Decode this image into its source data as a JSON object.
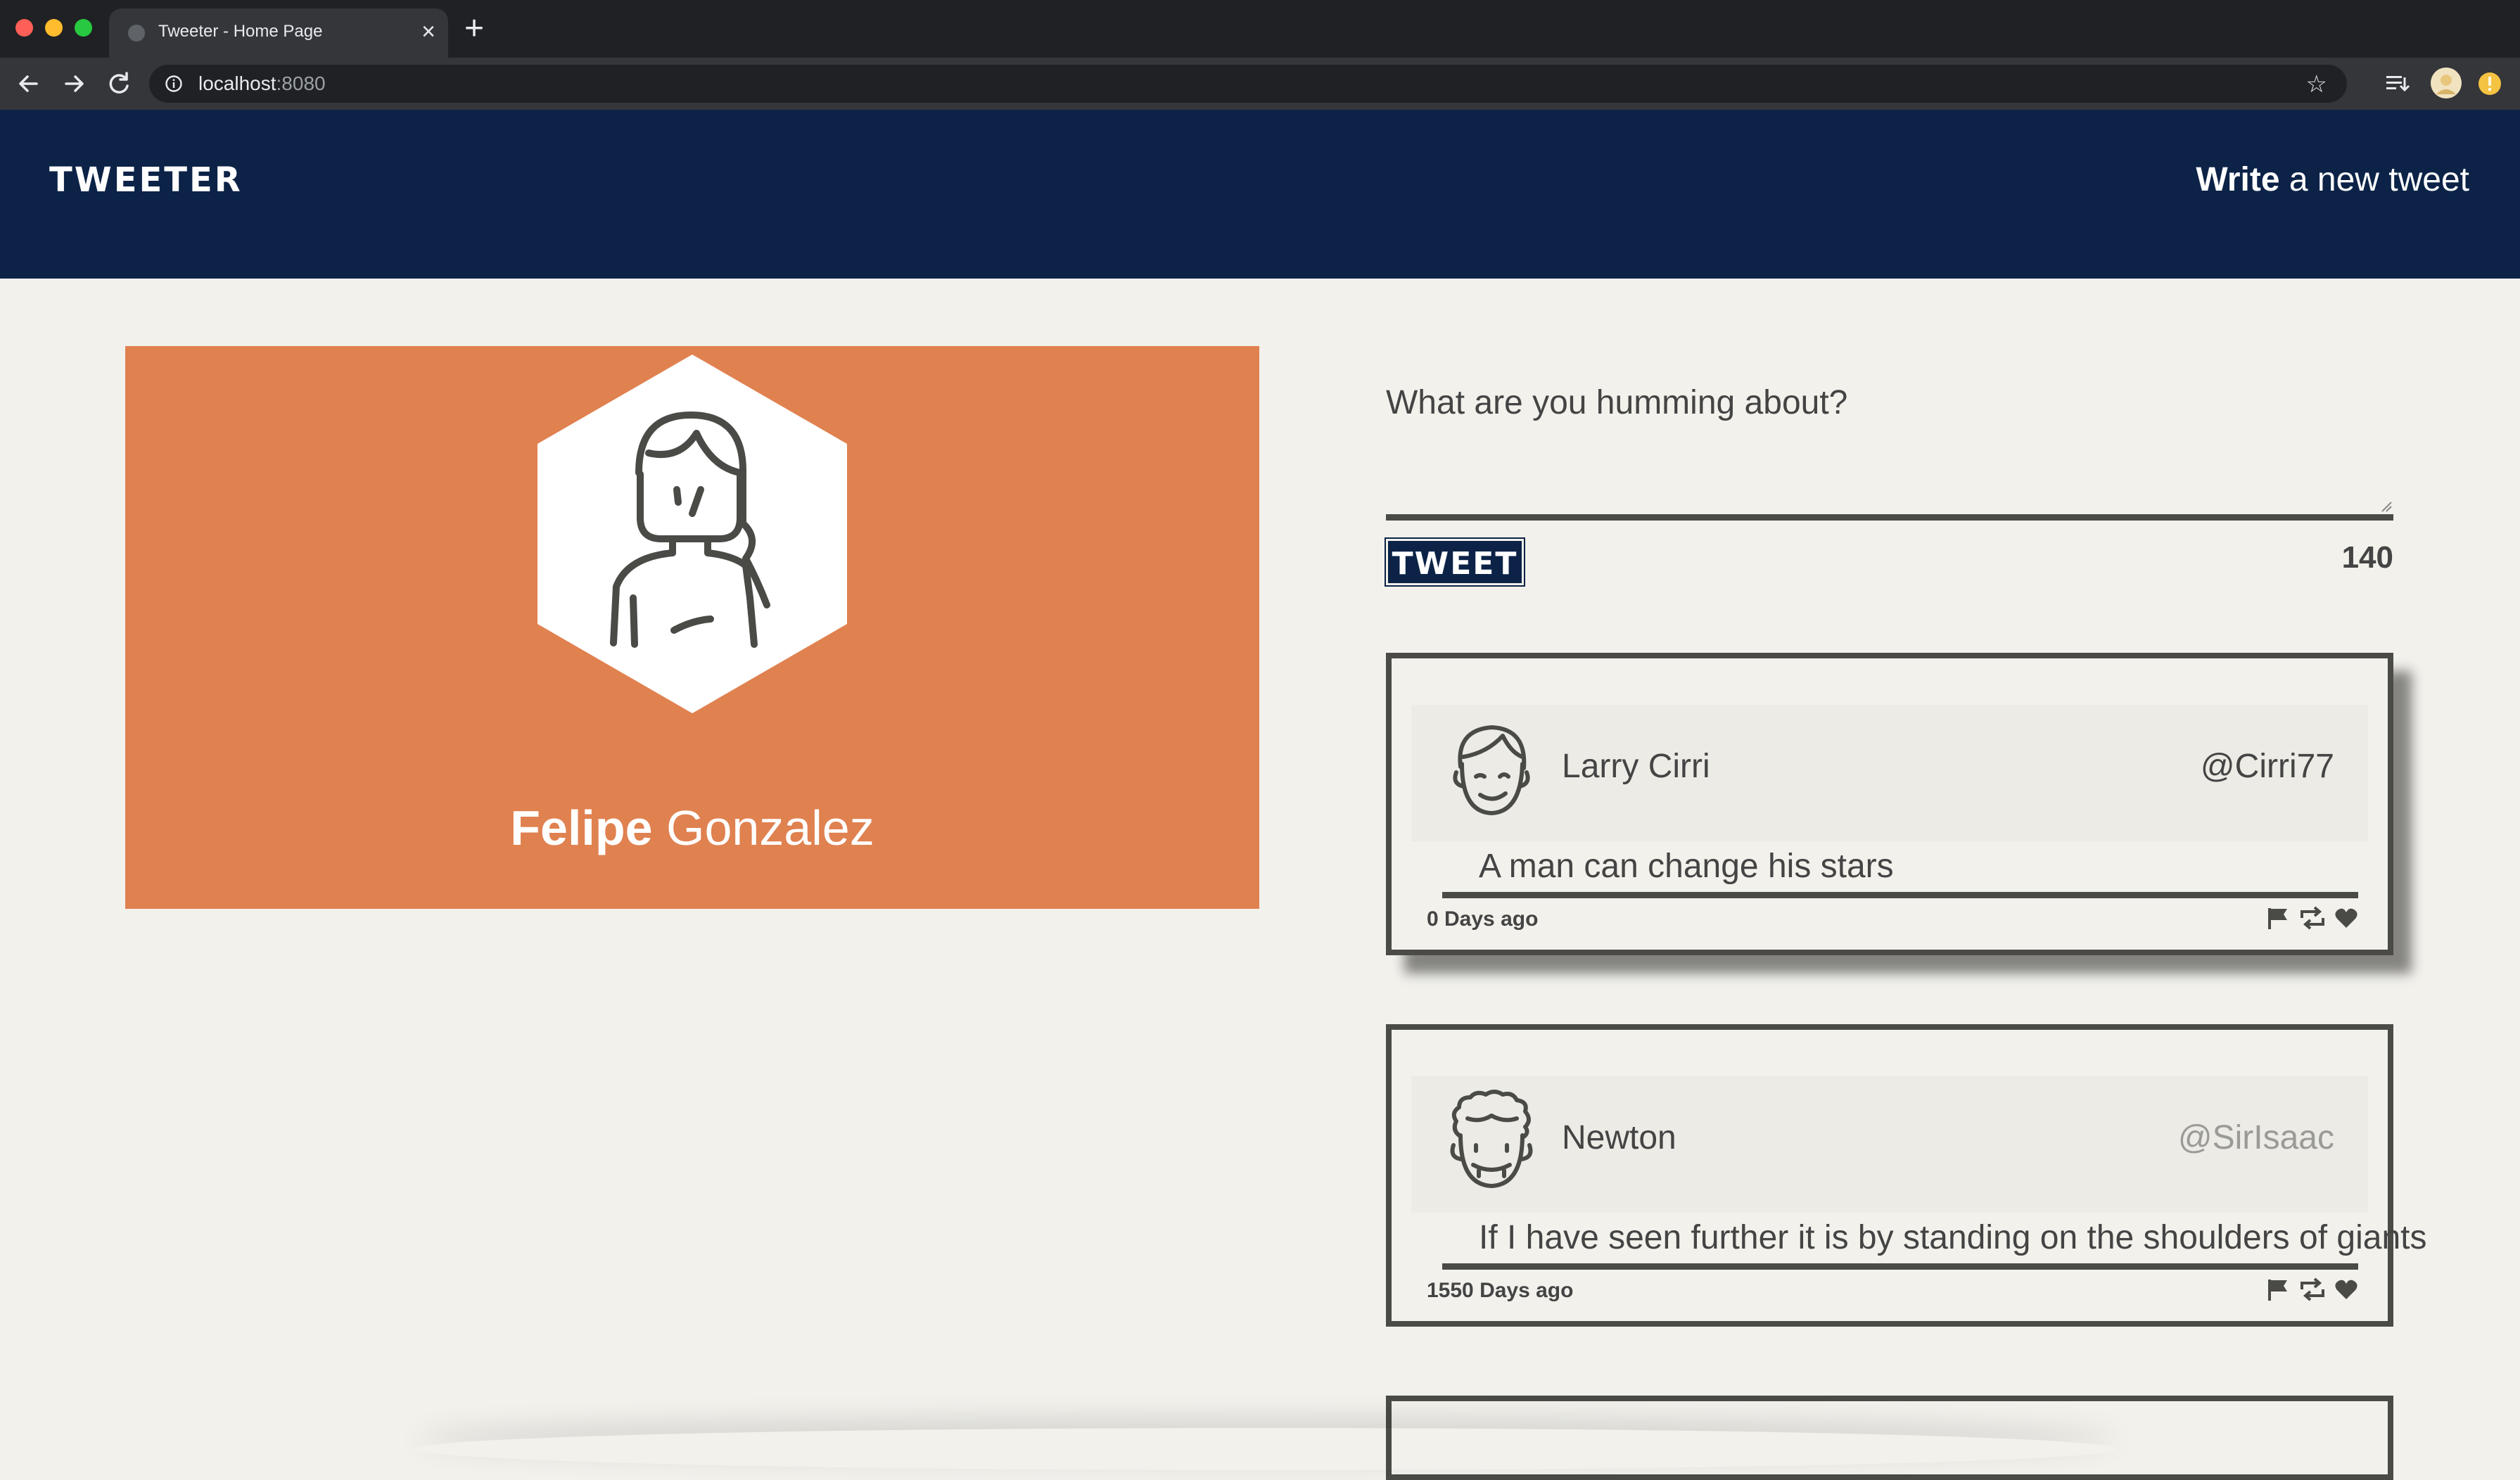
{
  "browser": {
    "tab_title": "Tweeter - Home Page",
    "tab_close": "×",
    "new_tab": "+",
    "url_host": "localhost",
    "url_port": ":8080",
    "bookmark_icon": "☆"
  },
  "header": {
    "brand": "TWEETER",
    "compose_bold": "Write",
    "compose_rest": " a new tweet"
  },
  "profile": {
    "first_name": "Felipe",
    "last_name": " Gonzalez",
    "accent_color": "#e08150"
  },
  "composer": {
    "prompt": "What are you humming about?",
    "button_label": "TWEET",
    "char_count": "140"
  },
  "tweets": [
    {
      "name": "Larry Cirri",
      "handle": "@Cirri77",
      "text": "A man can change his stars",
      "age": "0 Days ago",
      "avatar_icon": "boy-avatar-icon"
    },
    {
      "name": "Newton",
      "handle": "@SirIsaac",
      "text": "If I have seen further it is by standing on the shoulders of giants",
      "age": "1550 Days ago",
      "avatar_icon": "curly-hair-avatar-icon"
    }
  ],
  "colors": {
    "navy": "#0c2347",
    "background": "#f2f1ec",
    "border": "#4a4a46"
  }
}
